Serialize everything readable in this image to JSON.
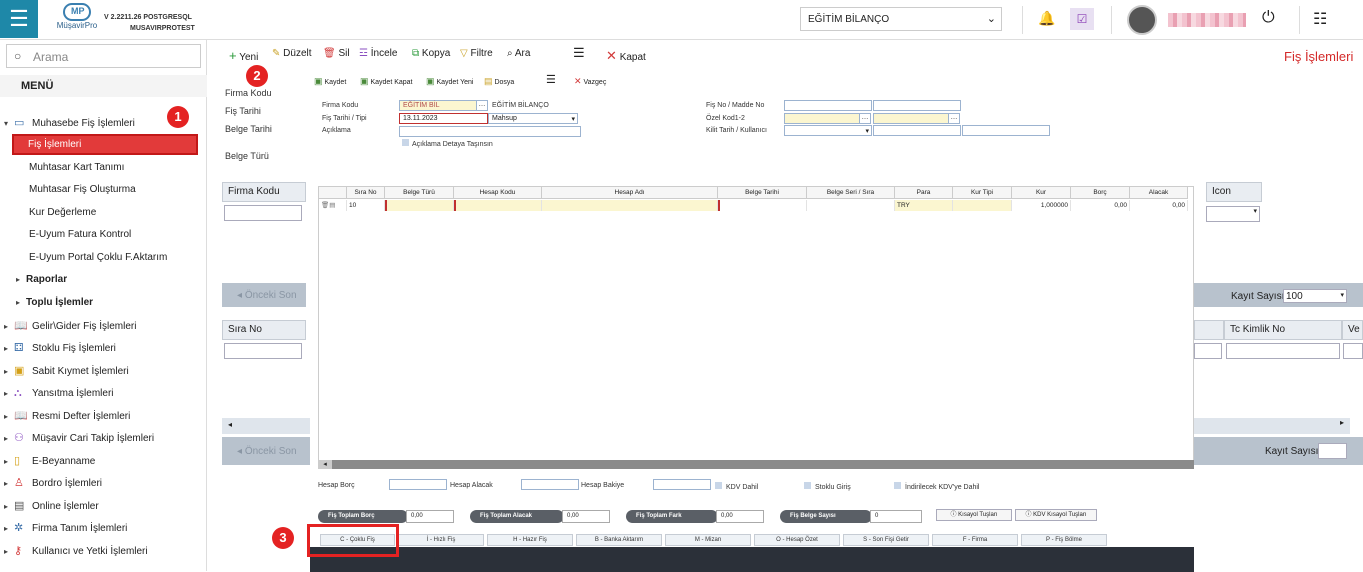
{
  "topbar": {
    "logo_text": "MüşavirPro",
    "logo_mark": "MP",
    "version_line1": "V 2.2211.26 POSTGRESQL",
    "version_line2": "MUSAVIRPROTEST",
    "company_select": "EĞİTİM BİLANÇO"
  },
  "sidebar": {
    "search_placeholder": "Arama",
    "menu_label": "MENÜ",
    "items": [
      {
        "label": "Muhasebe Fiş İşlemleri",
        "level": 0,
        "icon": "ledger-icon"
      },
      {
        "label": "Fiş İşlemleri",
        "level": 1,
        "active": true
      },
      {
        "label": "Muhtasar Kart Tanımı",
        "level": 1
      },
      {
        "label": "Muhtasar Fiş Oluşturma",
        "level": 1
      },
      {
        "label": "Kur Değerleme",
        "level": 1
      },
      {
        "label": "E-Uyum Fatura Kontrol",
        "level": 1
      },
      {
        "label": "E-Uyum Portal Çoklu F.Aktarım",
        "level": 1
      },
      {
        "label": "Raporlar",
        "level": 1,
        "bold": true
      },
      {
        "label": "Toplu İşlemler",
        "level": 1,
        "bold": true
      },
      {
        "label": "Gelir\\Gider Fiş İşlemleri",
        "level": 0,
        "icon": "book-icon"
      },
      {
        "label": "Stoklu Fiş İşlemleri",
        "level": 0,
        "icon": "boxes-icon"
      },
      {
        "label": "Sabit Kıymet İşlemleri",
        "level": 0,
        "icon": "asset-icon"
      },
      {
        "label": "Yansıtma İşlemleri",
        "level": 0,
        "icon": "reflect-icon"
      },
      {
        "label": "Resmi Defter İşlemleri",
        "level": 0,
        "icon": "book-icon"
      },
      {
        "label": "Müşavir Cari Takip İşlemleri",
        "level": 0,
        "icon": "people-icon"
      },
      {
        "label": "E-Beyanname",
        "level": 0,
        "icon": "phone-icon"
      },
      {
        "label": "Bordro İşlemleri",
        "level": 0,
        "icon": "person-icon"
      },
      {
        "label": "Online İşlemler",
        "level": 0,
        "icon": "window-icon"
      },
      {
        "label": "Firma Tanım İşlemleri",
        "level": 0,
        "icon": "gear-icon"
      },
      {
        "label": "Kullanıcı ve Yetki İşlemleri",
        "level": 0,
        "icon": "key-icon"
      }
    ]
  },
  "badges": {
    "one": "1",
    "two": "2",
    "three": "3"
  },
  "toolbar": {
    "new": "Yeni",
    "edit": "Düzelt",
    "delete": "Sil",
    "inspect": "İncele",
    "copy": "Kopya",
    "filter": "Filtre",
    "search": "Ara",
    "close": "Kapat"
  },
  "page_title": "Fiş İşlemleri",
  "background": {
    "labels": [
      "Firma Kodu",
      "Fiş Tarihi",
      "Belge Tarihi",
      "Belge Türü"
    ],
    "col_firma_kodu": "Firma Kodu",
    "col_icon": "Icon",
    "prev": "Önceki",
    "prev2": "Son",
    "record_count_label": "Kayıt Sayısı",
    "record_count_value": "100",
    "col_sira_no": "Sıra No",
    "col_tc_kimlik": "Tc Kimlik No",
    "col_ve": "Ve",
    "record_count_label2": "Kayıt Sayısı"
  },
  "modal": {
    "toolbar": {
      "save": "Kaydet",
      "save_close": "Kaydet Kapat",
      "save_new": "Kaydet Yeni",
      "file": "Dosya",
      "cancel": "Vazgeç"
    },
    "form": {
      "firma_kodu_label": "Firma Kodu",
      "firma_kodu_value": "EĞİTİM BİL",
      "firma_name": "EĞİTİM BİLANÇO",
      "fis_tarihi_label": "Fiş Tarihi / Tipi",
      "fis_tarihi_value": "13.11.2023",
      "fis_tipi_value": "Mahsup",
      "aciklama_label": "Açıklama",
      "aciklama_check": "Açıklama Detaya Taşınsın",
      "fis_no_label": "Fiş No / Madde No",
      "ozel_kod_label": "Özel Kod1-2",
      "kilit_label": "Kilit Tarih / Kullanıcı"
    },
    "grid": {
      "headers": [
        "Sıra No",
        "Belge Türü",
        "Hesap Kodu",
        "Hesap Adı",
        "Belge Tarihi",
        "Belge Seri / Sıra",
        "Para",
        "Kur Tipi",
        "Kur",
        "Borç",
        "Alacak"
      ],
      "row": {
        "sira": "10",
        "para": "TRY",
        "kur": "1,000000",
        "borc": "0,00",
        "alacak": "0,00"
      }
    },
    "footer": {
      "hesap_borc": "Hesap Borç",
      "hesap_alacak": "Hesap Alacak",
      "hesap_bakiye": "Hesap Bakiye",
      "kdv_dahil": "KDV Dahil",
      "stoklu_giris": "Stoklu Giriş",
      "indirilecek": "İndirilecek KDV'ye Dahil",
      "fis_toplam_borc": "Fiş Toplam Borç",
      "fis_toplam_borc_val": "0,00",
      "fis_toplam_alacak": "Fiş Toplam Alacak",
      "fis_toplam_alacak_val": "0,00",
      "fis_toplam_fark": "Fiş Toplam Fark",
      "fis_toplam_fark_val": "0,00",
      "fis_belge_sayisi": "Fiş Belge Sayısı",
      "fis_belge_sayisi_val": "0",
      "kisayol": "Kısayol Tuşları",
      "kdv_kisayol": "KDV Kısayol Tuşları"
    },
    "shortcuts": [
      "C - Çoklu Fiş",
      "İ - Hızlı Fiş",
      "H - Hazır Fiş",
      "B - Banka Aktarım",
      "M - Mizan",
      "O - Hesap Özet",
      "S - Son Fişi Getir",
      "F - Firma",
      "P - Fiş Bölme"
    ]
  }
}
